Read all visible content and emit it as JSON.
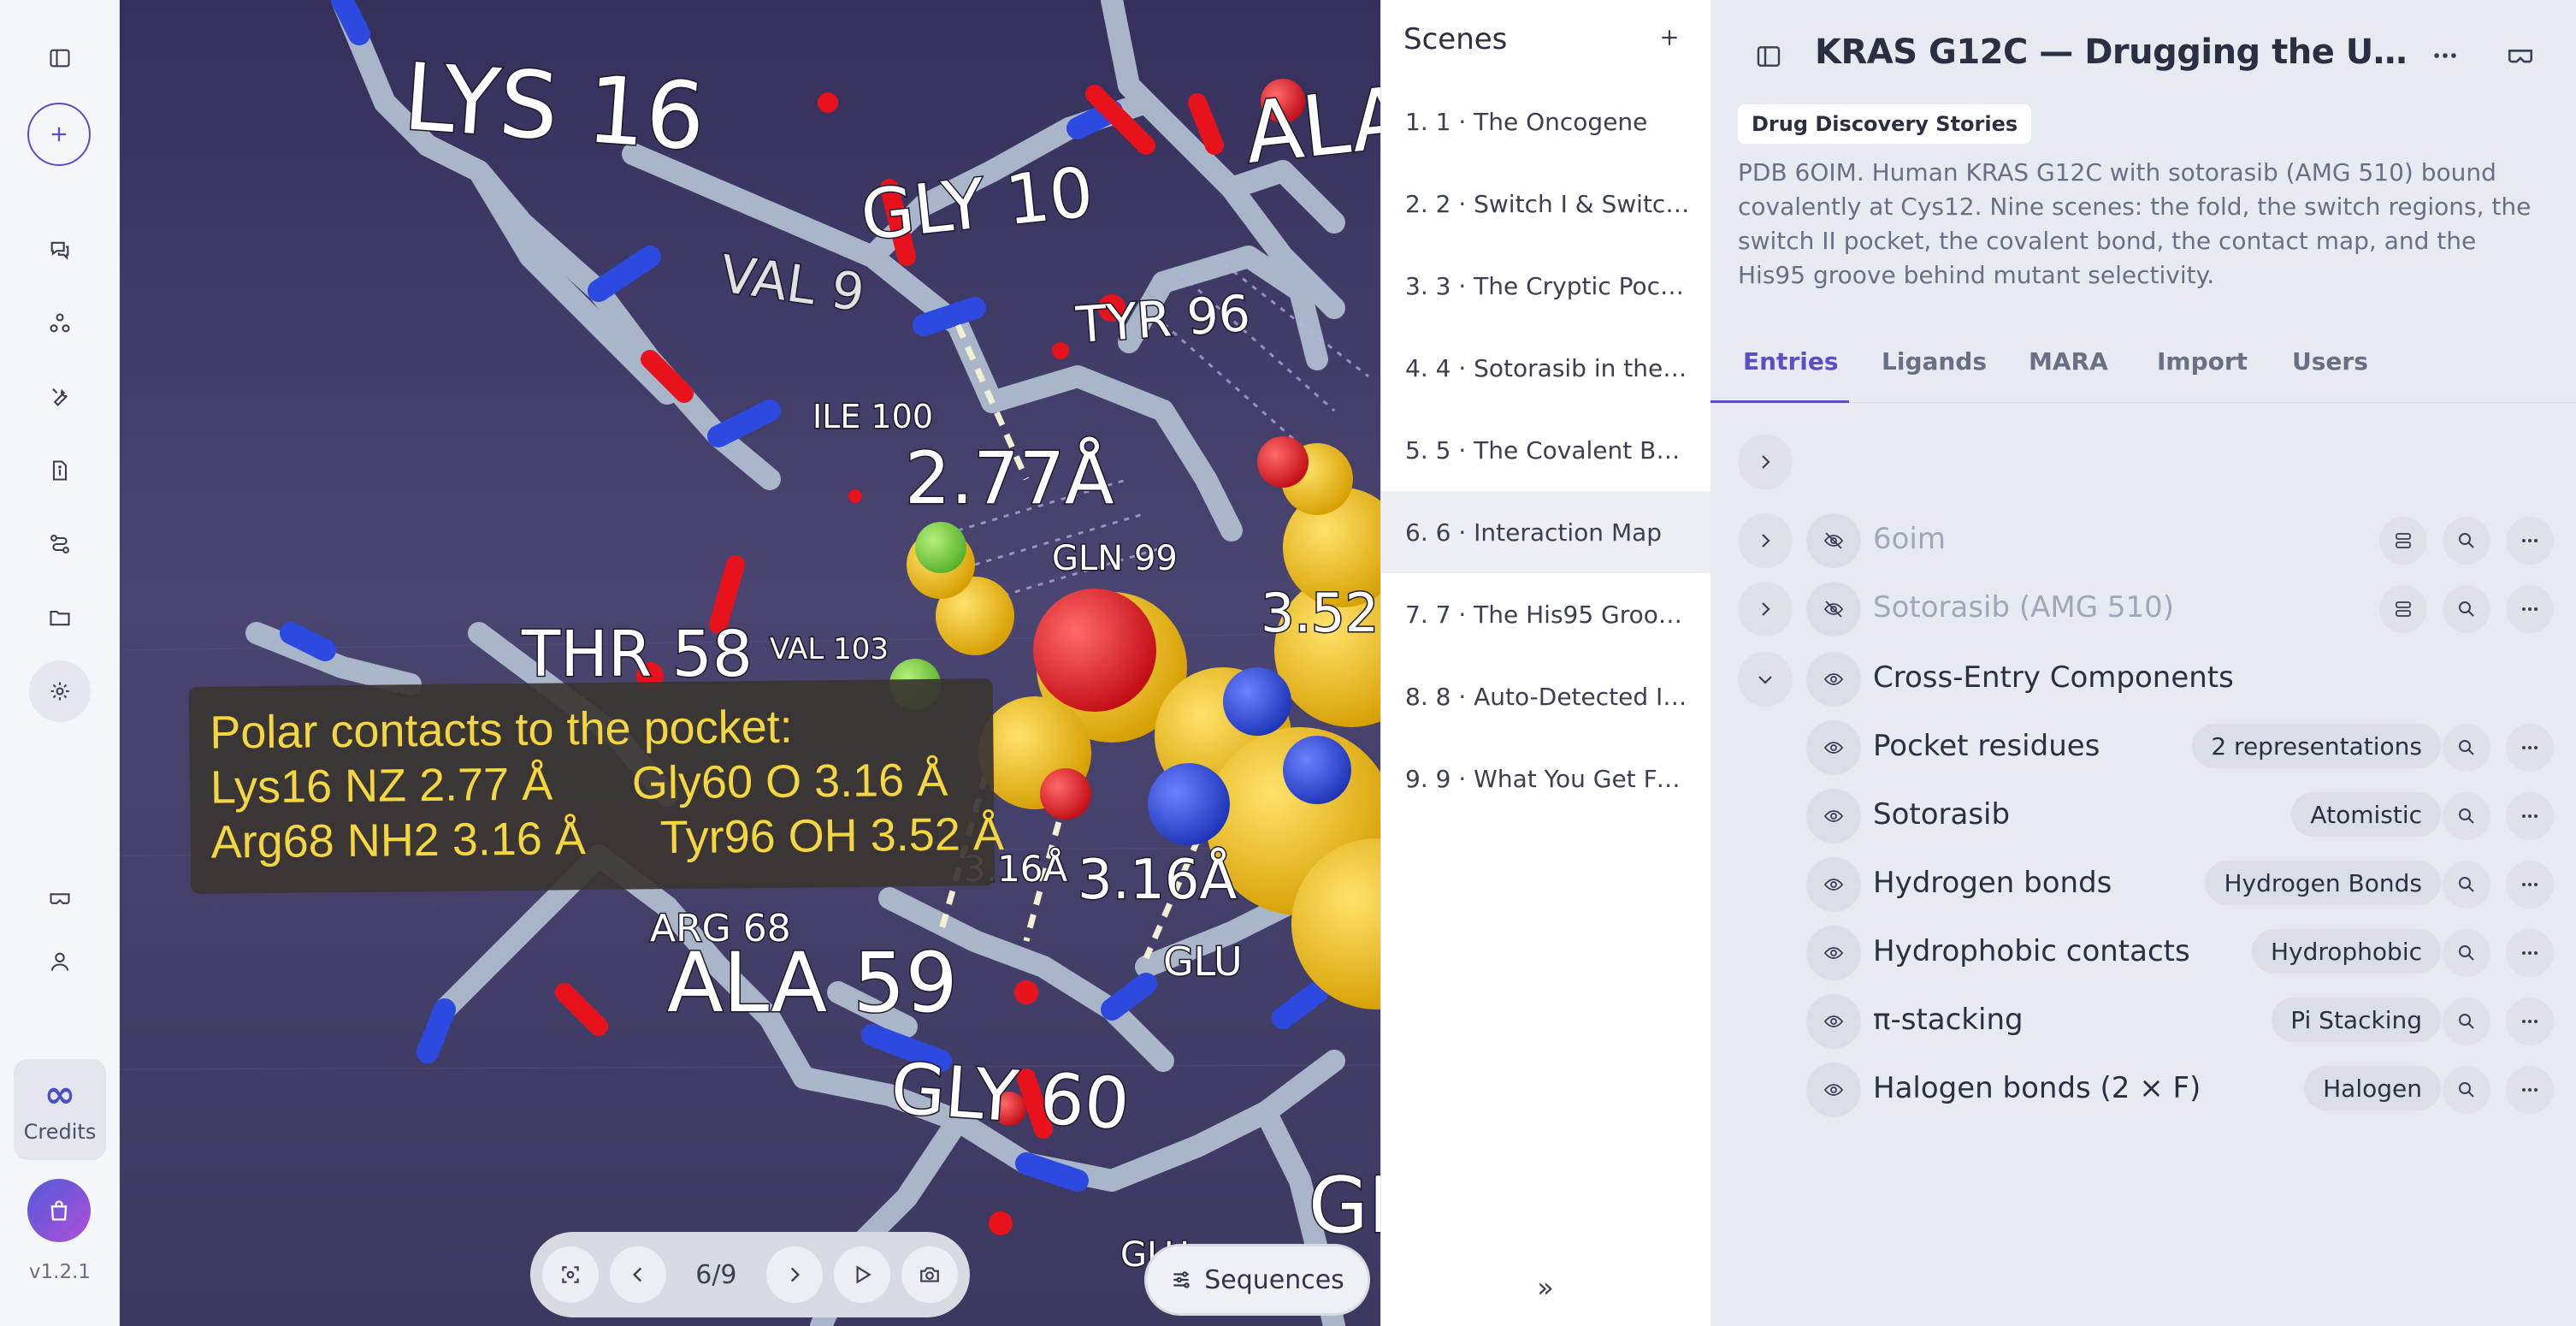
{
  "rail": {
    "credits_label": "Credits",
    "version": "v1.2.1"
  },
  "viewport": {
    "residue_labels": {
      "lys16": "LYS 16",
      "gly10": "GLY 10",
      "val9": "VAL 9",
      "tyr96": "TYR 96",
      "ile100": "ILE 100",
      "gln99": "GLN 99",
      "thr58": "THR 58",
      "val103": "VAL 103",
      "arg68": "ARG 68",
      "ala59": "ALA 59",
      "gly60": "GLY 60",
      "glu": "GLU",
      "ala_top": "ALA",
      "gl_bottom": "GL",
      "glu_bottom": "GLU"
    },
    "distance_labels": {
      "d1": "2.77Å",
      "d2": "3.52",
      "d3": "3.16Å",
      "d4": "3.16Å"
    },
    "caption": {
      "title": "Polar contacts to the pocket:",
      "row1_a": "Lys16 NZ 2.77 Å",
      "row1_b": "Gly60 O 3.16 Å",
      "row2_a": "Arg68 NH2 3.16 Å",
      "row2_b": "Tyr96 OH 3.52 Å"
    },
    "player": {
      "counter": "6/9"
    },
    "sequences_label": "Sequences"
  },
  "scenes": {
    "header": "Scenes",
    "items": [
      "1. 1 · The Oncogene",
      "2. 2 · Switch I & Switch II",
      "3. 3 · The Cryptic Pock…",
      "4. 4 · Sotorasib in the P…",
      "5. 5 · The Covalent Bo…",
      "6. 6 · Interaction Map",
      "7. 7 · The His95 Groove…",
      "8. 8 · Auto-Detected In…",
      "9. 9 · What You Get Fo…"
    ],
    "active_index": 5,
    "collapse_glyph": "»"
  },
  "panel": {
    "title": "KRAS G12C — Drugging the Undru…",
    "tag": "Drug Discovery Stories",
    "description": "PDB 6OIM. Human KRAS G12C with sotorasib (AMG 510) bound covalently at Cys12. Nine scenes: the fold, the switch regions, the switch II pocket, the covalent bond, the contact map, and the His95 groove behind mutant selectivity.",
    "tabs": [
      "Entries",
      "Ligands",
      "MARA",
      "Import",
      "Users"
    ],
    "active_tab": "Entries",
    "entries": [
      {
        "label": "6oim",
        "visible": false
      },
      {
        "label": "Sotorasib (AMG 510)",
        "visible": false
      },
      {
        "label": "Cross-Entry Components",
        "visible": true
      }
    ],
    "components": [
      {
        "label": "Pocket residues",
        "badge": "2 representations"
      },
      {
        "label": "Sotorasib",
        "badge": "Atomistic"
      },
      {
        "label": "Hydrogen bonds",
        "badge": "Hydrogen Bonds"
      },
      {
        "label": "Hydrophobic contacts",
        "badge": "Hydrophobic"
      },
      {
        "label": "π-stacking",
        "badge": "Pi Stacking"
      },
      {
        "label": "Halogen bonds (2 × F)",
        "badge": "Halogen"
      }
    ]
  },
  "colors": {
    "accent": "#5b4fc8",
    "carbon_protein": "#a9b6c9",
    "carbon_ligand": "#f5c21b",
    "oxygen": "#e8121c",
    "nitrogen": "#2c49e0",
    "fluorine": "#7ed348",
    "caption_text": "#f4d640"
  }
}
